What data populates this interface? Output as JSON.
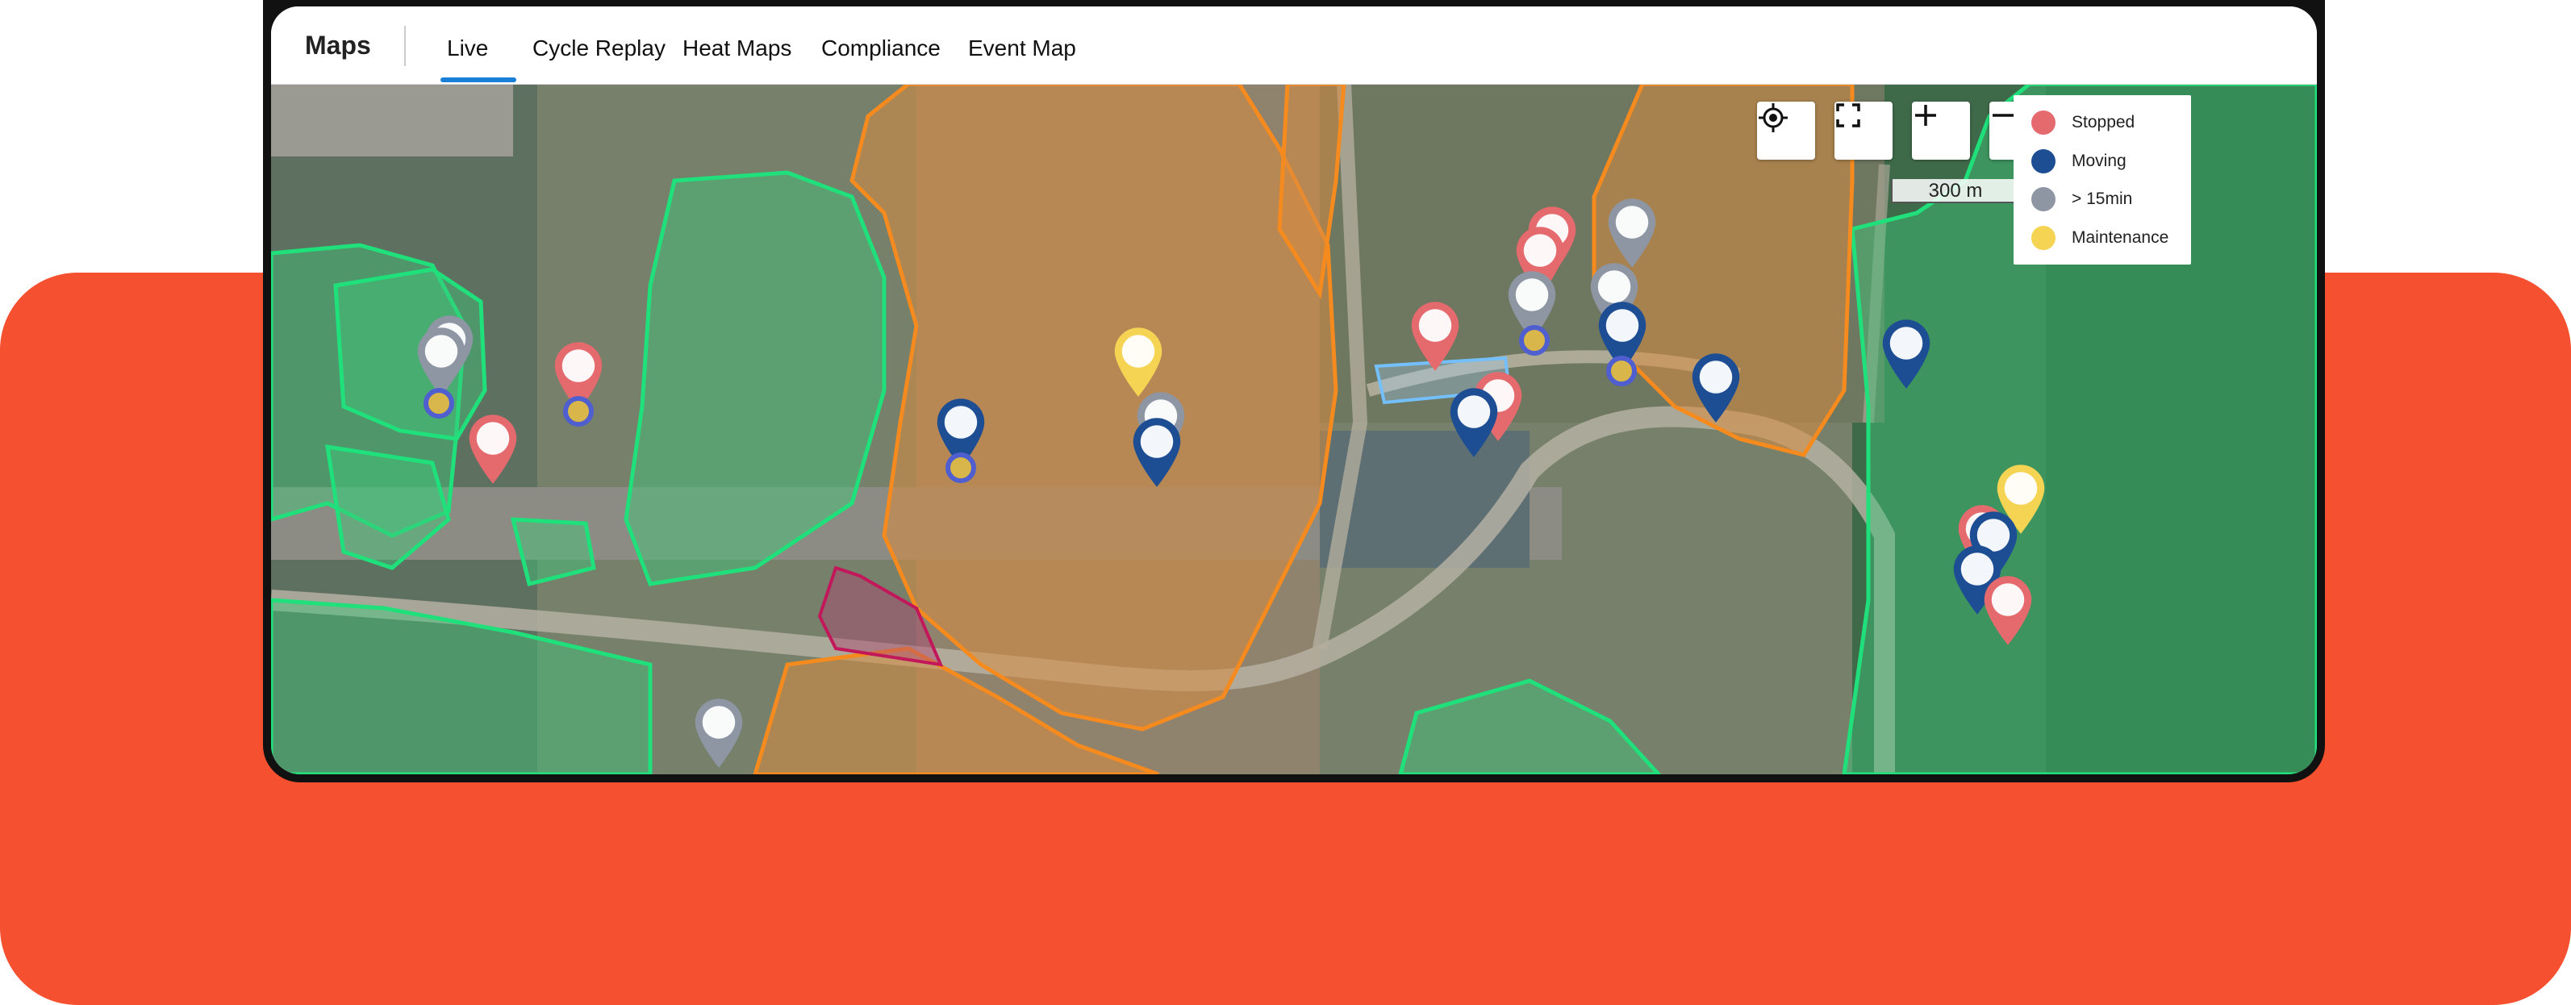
{
  "app": {
    "title": "Maps"
  },
  "nav": {
    "tabs": [
      {
        "label": "Live",
        "active": true
      },
      {
        "label": "Cycle Replay",
        "active": false
      },
      {
        "label": "Heat Maps",
        "active": false
      },
      {
        "label": "Compliance",
        "active": false
      },
      {
        "label": "Event Map",
        "active": false
      }
    ]
  },
  "map": {
    "scale_label": "300 m",
    "controls": [
      "locate-icon",
      "fullscreen-icon",
      "zoom-in-icon",
      "zoom-out-icon",
      "road-icon"
    ],
    "legend": [
      {
        "label": "Stopped",
        "color": "#e46a6e"
      },
      {
        "label": "Moving",
        "color": "#1d4e94"
      },
      {
        "label": "> 15min",
        "color": "#8e96a4"
      },
      {
        "label": "Maintenance",
        "color": "#f5d453"
      }
    ]
  },
  "colors": {
    "accent": "#1a7fd6",
    "background_band": "#f5502f",
    "zone_green": "#2bd67b",
    "zone_orange": "#f58a1f"
  }
}
